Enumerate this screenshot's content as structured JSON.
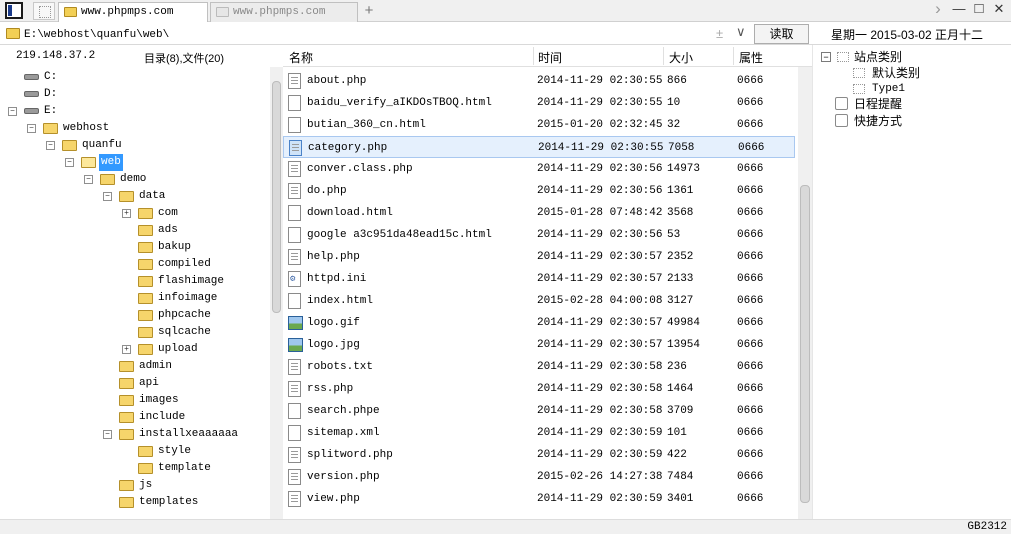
{
  "tabs": [
    {
      "label": "www.phpmps.com",
      "active": true
    },
    {
      "label": "www.phpmps.com",
      "active": false
    }
  ],
  "window_controls": {
    "chevron": "›",
    "minimize": "—",
    "maximize": "□",
    "close": "✕"
  },
  "new_tab_symbol": "+",
  "address": {
    "path": "E:\\webhost\\quanfu\\web\\",
    "plus": "±",
    "dropdown": "∨",
    "read_button": "读取"
  },
  "date_label": "星期一  2015-03-02  正月十二",
  "status": {
    "ip": "219.148.37.2",
    "counts": "目录(8),文件(20)"
  },
  "columns": {
    "name": "名称",
    "time": "时间",
    "size": "大小",
    "attr": "属性"
  },
  "tree": [
    {
      "label": "C:",
      "type": "drive",
      "level": 0,
      "expander": ""
    },
    {
      "label": "D:",
      "type": "drive",
      "level": 0,
      "expander": ""
    },
    {
      "label": "E:",
      "type": "drive",
      "level": 0,
      "expander": "−"
    },
    {
      "label": "webhost",
      "type": "folder",
      "level": 1,
      "expander": "−"
    },
    {
      "label": "quanfu",
      "type": "folder",
      "level": 2,
      "expander": "−"
    },
    {
      "label": "web",
      "type": "folder",
      "level": 3,
      "expander": "−",
      "selected": true,
      "open": true
    },
    {
      "label": "demo",
      "type": "folder",
      "level": 4,
      "expander": "−"
    },
    {
      "label": "data",
      "type": "folder",
      "level": 5,
      "expander": "−"
    },
    {
      "label": "com",
      "type": "folder",
      "level": 6,
      "expander": "+"
    },
    {
      "label": "ads",
      "type": "folder",
      "level": 6,
      "expander": ""
    },
    {
      "label": "bakup",
      "type": "folder",
      "level": 6,
      "expander": ""
    },
    {
      "label": "compiled",
      "type": "folder",
      "level": 6,
      "expander": ""
    },
    {
      "label": "flashimage",
      "type": "folder",
      "level": 6,
      "expander": ""
    },
    {
      "label": "infoimage",
      "type": "folder",
      "level": 6,
      "expander": ""
    },
    {
      "label": "phpcache",
      "type": "folder",
      "level": 6,
      "expander": ""
    },
    {
      "label": "sqlcache",
      "type": "folder",
      "level": 6,
      "expander": ""
    },
    {
      "label": "upload",
      "type": "folder",
      "level": 6,
      "expander": "+"
    },
    {
      "label": "admin",
      "type": "folder",
      "level": 5,
      "expander": ""
    },
    {
      "label": "api",
      "type": "folder",
      "level": 5,
      "expander": ""
    },
    {
      "label": "images",
      "type": "folder",
      "level": 5,
      "expander": ""
    },
    {
      "label": "include",
      "type": "folder",
      "level": 5,
      "expander": ""
    },
    {
      "label": "installxeaaaaaa",
      "type": "folder",
      "level": 5,
      "expander": "−"
    },
    {
      "label": "style",
      "type": "folder",
      "level": 6,
      "expander": ""
    },
    {
      "label": "template",
      "type": "folder",
      "level": 6,
      "expander": ""
    },
    {
      "label": "js",
      "type": "folder",
      "level": 5,
      "expander": ""
    },
    {
      "label": "templates",
      "type": "folder",
      "level": 5,
      "expander": ""
    }
  ],
  "files": [
    {
      "name": "about.php",
      "time": "2014-11-29 02:30:55",
      "size": "866",
      "attr": "0666",
      "icon": "php"
    },
    {
      "name": "baidu_verify_aIKDOsTBOQ.html",
      "time": "2014-11-29 02:30:55",
      "size": "10",
      "attr": "0666",
      "icon": "doc"
    },
    {
      "name": "butian_360_cn.html",
      "time": "2015-01-20 02:32:45",
      "size": "32",
      "attr": "0666",
      "icon": "doc"
    },
    {
      "name": "category.php",
      "time": "2014-11-29 02:30:55",
      "size": "7058",
      "attr": "0666",
      "icon": "php",
      "selected": true
    },
    {
      "name": "conver.class.php",
      "time": "2014-11-29 02:30:56",
      "size": "14973",
      "attr": "0666",
      "icon": "php"
    },
    {
      "name": "do.php",
      "time": "2014-11-29 02:30:56",
      "size": "1361",
      "attr": "0666",
      "icon": "php"
    },
    {
      "name": "download.html",
      "time": "2015-01-28 07:48:42",
      "size": "3568",
      "attr": "0666",
      "icon": "doc"
    },
    {
      "name": "google a3c951da48ead15c.html",
      "time": "2014-11-29 02:30:56",
      "size": "53",
      "attr": "0666",
      "icon": "doc"
    },
    {
      "name": "help.php",
      "time": "2014-11-29 02:30:57",
      "size": "2352",
      "attr": "0666",
      "icon": "php"
    },
    {
      "name": "httpd.ini",
      "time": "2014-11-29 02:30:57",
      "size": "2133",
      "attr": "0666",
      "icon": "conf"
    },
    {
      "name": "index.html",
      "time": "2015-02-28 04:00:08",
      "size": "3127",
      "attr": "0666",
      "icon": "doc"
    },
    {
      "name": "logo.gif",
      "time": "2014-11-29 02:30:57",
      "size": "49984",
      "attr": "0666",
      "icon": "img"
    },
    {
      "name": "logo.jpg",
      "time": "2014-11-29 02:30:57",
      "size": "13954",
      "attr": "0666",
      "icon": "img"
    },
    {
      "name": "robots.txt",
      "time": "2014-11-29 02:30:58",
      "size": "236",
      "attr": "0666",
      "icon": "php"
    },
    {
      "name": "rss.php",
      "time": "2014-11-29 02:30:58",
      "size": "1464",
      "attr": "0666",
      "icon": "php"
    },
    {
      "name": "search.phpe",
      "time": "2014-11-29 02:30:58",
      "size": "3709",
      "attr": "0666",
      "icon": "doc"
    },
    {
      "name": "sitemap.xml",
      "time": "2014-11-29 02:30:59",
      "size": "101",
      "attr": "0666",
      "icon": "doc"
    },
    {
      "name": "splitword.php",
      "time": "2014-11-29 02:30:59",
      "size": "422",
      "attr": "0666",
      "icon": "php"
    },
    {
      "name": "version.php",
      "time": "2015-02-26 14:27:38",
      "size": "7484",
      "attr": "0666",
      "icon": "php"
    },
    {
      "name": "view.php",
      "time": "2014-11-29 02:30:59",
      "size": "3401",
      "attr": "0666",
      "icon": "php"
    }
  ],
  "right_panel": {
    "site_category": "站点类别",
    "default_category": "默认类别",
    "type1": "Type1",
    "schedule": "日程提醒",
    "shortcut": "快捷方式",
    "collapse_symbol": "−"
  },
  "encoding": "GB2312"
}
